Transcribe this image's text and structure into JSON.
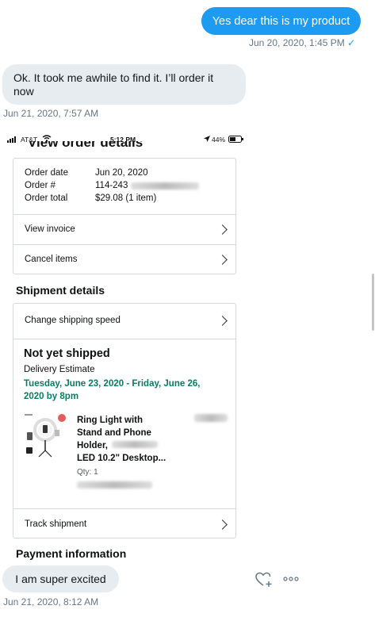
{
  "messages": {
    "sent1": {
      "text": "Yes dear this is my product",
      "meta": "Jun 20, 2020, 1:45 PM",
      "status_glyph": "✓"
    },
    "recv1": {
      "text": "Ok. It took me awhile to find it. I’ll order it now",
      "meta": "Jun 21, 2020, 7:57 AM"
    },
    "recv2": {
      "text": "I am super excited",
      "meta": "Jun 21, 2020, 8:12 AM"
    }
  },
  "screenshot": {
    "status_bar": {
      "carrier": "AT&T",
      "time": "5:12 PM",
      "battery": "44%"
    },
    "header_cut": "View order details",
    "order": {
      "date_label": "Order date",
      "date_value": "Jun 20, 2020",
      "number_label": "Order #",
      "number_value": "114-243",
      "total_label": "Order total",
      "total_value": "$29.08 (1 item)"
    },
    "actions": {
      "view_invoice": "View invoice",
      "cancel_items": "Cancel items"
    },
    "shipment_title": "Shipment details",
    "change_shipping": "Change shipping speed",
    "status_title": "Not yet shipped",
    "delivery_label": "Delivery Estimate",
    "delivery_dates": "Tuesday, June 23, 2020 - Friday, June 26, 2020 by 8pm",
    "product": {
      "title_line1": "Ring Light with",
      "title_line2": "Stand and Phone",
      "title_line3": "Holder,",
      "title_line4": "LED 10.2\" Desktop...",
      "qty": "Qty: 1"
    },
    "track": "Track shipment",
    "payment_title": "Payment information"
  },
  "icons": [
    "wifi-icon",
    "signal-icon",
    "location-arrow-icon",
    "battery-icon",
    "chevron-right-icon",
    "heart-plus-icon",
    "more-icon"
  ],
  "colors": {
    "sent_bubble": "#1d9bf0",
    "received_bubble": "#e6ecf0",
    "delivery_green": "#067d62"
  }
}
